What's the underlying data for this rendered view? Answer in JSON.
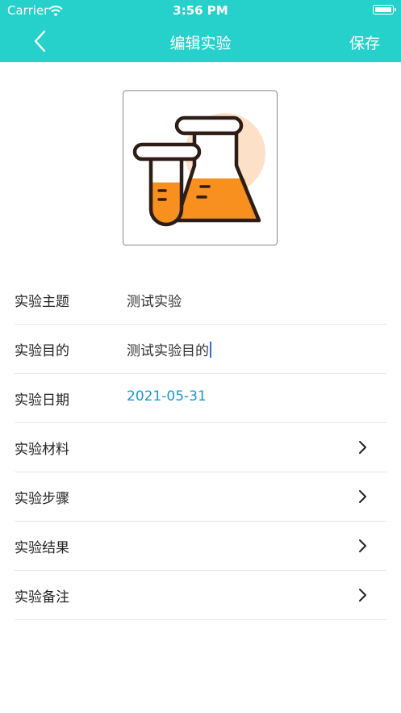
{
  "status_bar": {
    "carrier": "Carrier",
    "time": "3:56 PM"
  },
  "nav": {
    "title": "编辑实验",
    "save_label": "保存",
    "back_icon": "chevron-left-icon"
  },
  "avatar": {
    "icon": "lab-flask-icon",
    "accent": "#f7901e"
  },
  "colors": {
    "header_bg": "#26d1cc",
    "date_text": "#1a98d4",
    "caret": "#2f6ee8"
  },
  "form": {
    "rows": [
      {
        "label": "实验主题",
        "value": "测试实验"
      },
      {
        "label": "实验目的",
        "value": "测试实验目的"
      },
      {
        "label": "实验日期",
        "value": "2021-05-31"
      },
      {
        "label": "实验材料"
      },
      {
        "label": "实验步骤"
      },
      {
        "label": "实验结果"
      },
      {
        "label": "实验备注"
      }
    ]
  }
}
